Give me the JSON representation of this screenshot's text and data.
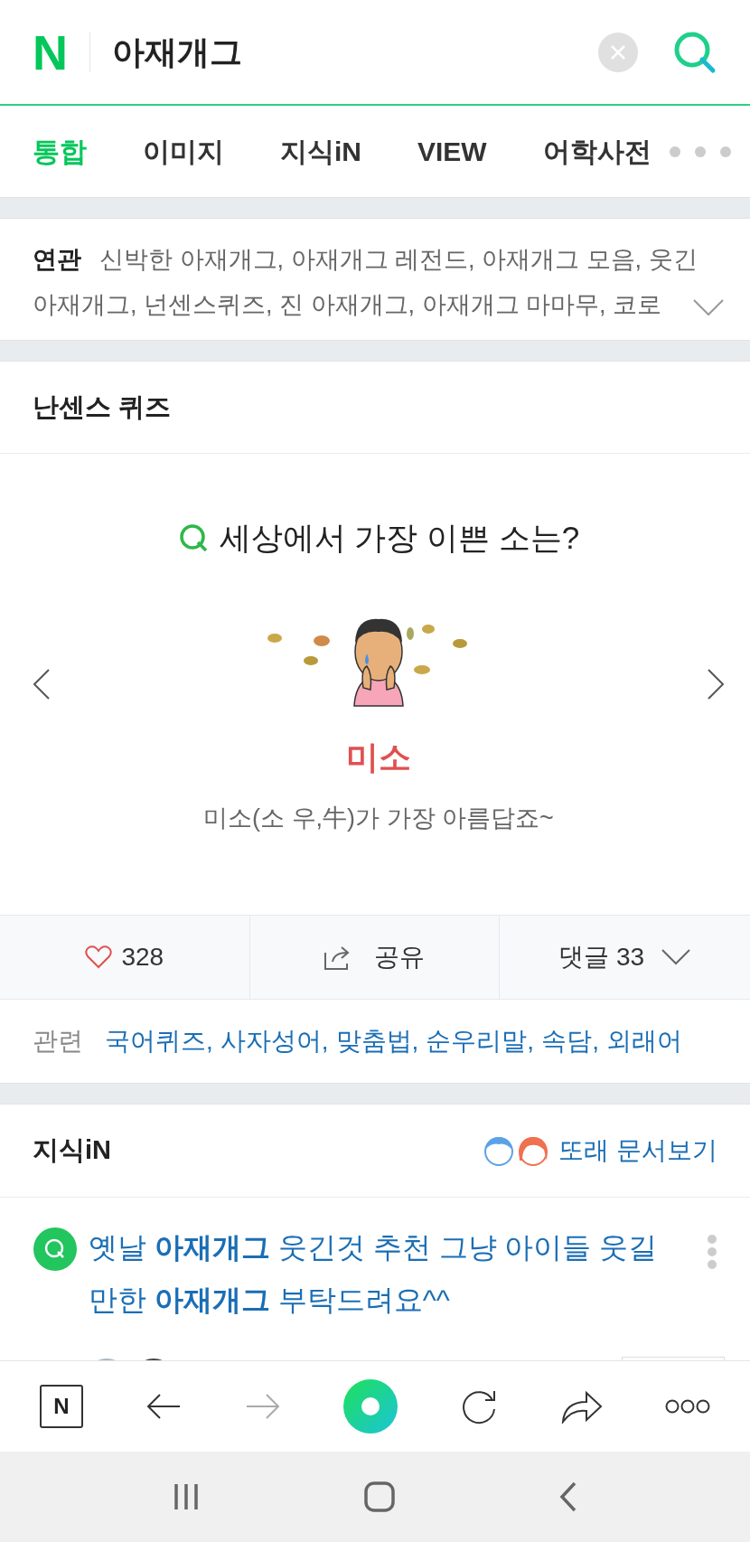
{
  "search": {
    "logo": "N",
    "query": "아재개그"
  },
  "tabs": [
    {
      "label": "통합",
      "selected": true
    },
    {
      "label": "이미지",
      "selected": false
    },
    {
      "label": "지식iN",
      "selected": false
    },
    {
      "label": "VIEW",
      "selected": false
    },
    {
      "label": "어학사전",
      "selected": false
    }
  ],
  "related": {
    "label": "연관",
    "lines": [
      "신박한 아재개그, 아재개그 레전드, 아재개그 모음, 웃긴",
      "아재개그, 넌센스퀴즈, 진 아재개그, 아재개그 마마무, 코로"
    ]
  },
  "quiz": {
    "title": "난센스 퀴즈",
    "question": "세상에서 가장 이쁜 소는?",
    "answer": "미소",
    "explanation": "미소(소 우,牛)가 가장 아름답죠~",
    "likes": "328",
    "share": "공유",
    "comments": "댓글 33"
  },
  "related_links": {
    "label": "관련",
    "links": [
      "국어퀴즈,",
      "사자성어,",
      "맞춤법,",
      "순우리말,",
      "속담,",
      "외래어"
    ]
  },
  "kin": {
    "title": "지식iN",
    "peer_link": "또래 문서보기",
    "question": "옛날 **아재개그** 웃긴것 추천 그냥 아이들 웃길 만한 **아재개그** 부탁드려요^^"
  },
  "toolbar": {
    "home_label": "N"
  }
}
